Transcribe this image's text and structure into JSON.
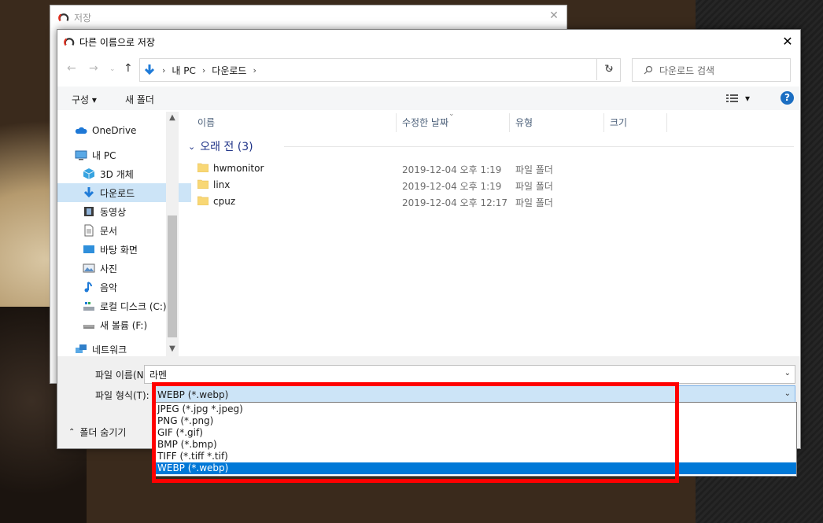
{
  "back_window": {
    "title": "저장",
    "close": "✕"
  },
  "dialog": {
    "title": "다른 이름으로 저장",
    "close": "✕",
    "address": {
      "items": [
        "내 PC",
        "다운로드"
      ],
      "sep": "›"
    },
    "search_placeholder": "다운로드 검색",
    "toolbar": {
      "organize": "구성 ▾",
      "new_folder": "새 폴더",
      "view": "▾",
      "help": "?"
    },
    "sidebar": {
      "items": [
        {
          "label": "OneDrive",
          "icon": "cloud-icon"
        },
        {
          "label": "내 PC",
          "icon": "computer-icon"
        },
        {
          "label": "3D 개체",
          "icon": "cube-icon"
        },
        {
          "label": "다운로드",
          "icon": "download-arrow-icon",
          "selected": true
        },
        {
          "label": "동영상",
          "icon": "film-icon"
        },
        {
          "label": "문서",
          "icon": "document-icon"
        },
        {
          "label": "바탕 화면",
          "icon": "desktop-icon"
        },
        {
          "label": "사진",
          "icon": "picture-icon"
        },
        {
          "label": "음악",
          "icon": "music-icon"
        },
        {
          "label": "로컬 디스크 (C:)",
          "icon": "drive-icon"
        },
        {
          "label": "새 볼륨 (F:)",
          "icon": "drive-icon"
        },
        {
          "label": "네트워크",
          "icon": "network-icon"
        }
      ]
    },
    "columns": {
      "name": "이름",
      "date": "수정한 날짜",
      "type": "유형",
      "size": "크기"
    },
    "group": {
      "label": "오래 전 (3)"
    },
    "files": [
      {
        "name": "hwmonitor",
        "date": "2019-12-04 오후 1:19",
        "type": "파일 폴더"
      },
      {
        "name": "linx",
        "date": "2019-12-04 오후 1:19",
        "type": "파일 폴더"
      },
      {
        "name": "cpuz",
        "date": "2019-12-04 오후 12:17",
        "type": "파일 폴더"
      }
    ],
    "filename_label": "파일 이름(N):",
    "filename_value": "라멘",
    "filetype_label": "파일 형식(T):",
    "filetype_value": "WEBP (*.webp)",
    "hide_folders": "폴더 숨기기",
    "filetype_options": [
      "JPEG (*.jpg *.jpeg)",
      "PNG (*.png)",
      "GIF (*.gif)",
      "BMP (*.bmp)",
      "TIFF (*.tiff *.tif)",
      "WEBP (*.webp)"
    ],
    "selected_option_index": 5
  },
  "colors": {
    "accent": "#0078d7",
    "highlight_box": "#ff0000",
    "selection": "#cce4f7"
  }
}
